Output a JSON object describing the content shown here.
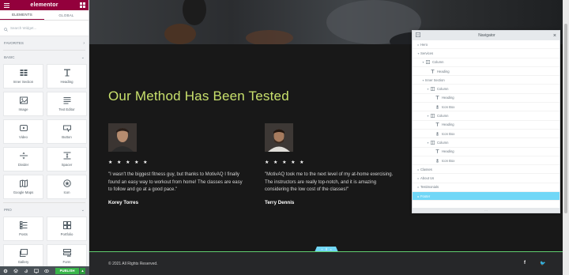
{
  "panel": {
    "logo": "elementor",
    "tabs": [
      "ELEMENTS",
      "GLOBAL"
    ],
    "search_placeholder": "Search Widget...",
    "categories": {
      "favorites": "FAVORITES",
      "basic": "BASIC",
      "pro": "PRO"
    },
    "basic_widgets": [
      {
        "label": "Inner Section",
        "icon": "inner-section-icon"
      },
      {
        "label": "Heading",
        "icon": "heading-icon"
      },
      {
        "label": "Image",
        "icon": "image-icon"
      },
      {
        "label": "Text Editor",
        "icon": "text-editor-icon"
      },
      {
        "label": "Video",
        "icon": "video-icon"
      },
      {
        "label": "Button",
        "icon": "button-icon"
      },
      {
        "label": "Divider",
        "icon": "divider-icon"
      },
      {
        "label": "Spacer",
        "icon": "spacer-icon"
      },
      {
        "label": "Google Maps",
        "icon": "google-maps-icon"
      },
      {
        "label": "Icon",
        "icon": "icon-widget-icon"
      }
    ],
    "pro_widgets": [
      {
        "label": "Posts",
        "icon": "posts-icon"
      },
      {
        "label": "Portfolio",
        "icon": "portfolio-icon"
      },
      {
        "label": "Gallery",
        "icon": "gallery-icon"
      },
      {
        "label": "Form",
        "icon": "form-icon"
      }
    ],
    "publish_label": "PUBLISH",
    "brand_color": "#93003c",
    "publish_color": "#39b54a"
  },
  "page": {
    "section_title": "Our Method Has Been Tested",
    "title_color": "#c8e06c",
    "testimonials": [
      {
        "stars": "★ ★ ★ ★ ★",
        "quote": "\"I wasn't the biggest fitness guy, but thanks to MotivAQ I finally found an easy way to workout from home! The classes are easy to follow and go at a good pace.\"",
        "name": "Korey Torres"
      },
      {
        "stars": "★ ★ ★ ★ ★",
        "quote": "\"MotivAQ took me to the next level of my at-home exercising. The instructors are really top-notch, and it is amazing considering the low cost of the classes!\"",
        "name": "Terry Dennis"
      }
    ],
    "footer": {
      "copyright": "© 2021 All Rights Reserved.",
      "social": [
        "f",
        "🐦"
      ]
    }
  },
  "navigator": {
    "title": "Navigator",
    "items": [
      {
        "label": "Hero",
        "depth": 0,
        "icon": ""
      },
      {
        "label": "Services",
        "depth": 0,
        "icon": ""
      },
      {
        "label": "Column",
        "depth": 1,
        "icon": "column-icon"
      },
      {
        "label": "Heading",
        "depth": 2,
        "icon": "heading-icon"
      },
      {
        "label": "Inner Section",
        "depth": 1,
        "icon": ""
      },
      {
        "label": "Column",
        "depth": 2,
        "icon": "column-icon"
      },
      {
        "label": "Heading",
        "depth": 3,
        "icon": "heading-icon"
      },
      {
        "label": "Icon Box",
        "depth": 3,
        "icon": "icon-box-icon"
      },
      {
        "label": "Column",
        "depth": 2,
        "icon": "column-icon"
      },
      {
        "label": "Heading",
        "depth": 3,
        "icon": "heading-icon"
      },
      {
        "label": "Icon Box",
        "depth": 3,
        "icon": "icon-box-icon"
      },
      {
        "label": "Column",
        "depth": 2,
        "icon": "column-icon"
      },
      {
        "label": "Heading",
        "depth": 3,
        "icon": "heading-icon"
      },
      {
        "label": "Icon Box",
        "depth": 3,
        "icon": "icon-box-icon"
      },
      {
        "label": "Classes",
        "depth": 0,
        "icon": ""
      },
      {
        "label": "About Us",
        "depth": 0,
        "icon": ""
      },
      {
        "label": "Testimonials",
        "depth": 0,
        "icon": ""
      },
      {
        "label": "Footer",
        "depth": 0,
        "icon": "",
        "selected": true
      }
    ],
    "selected_color": "#71d7f7"
  }
}
